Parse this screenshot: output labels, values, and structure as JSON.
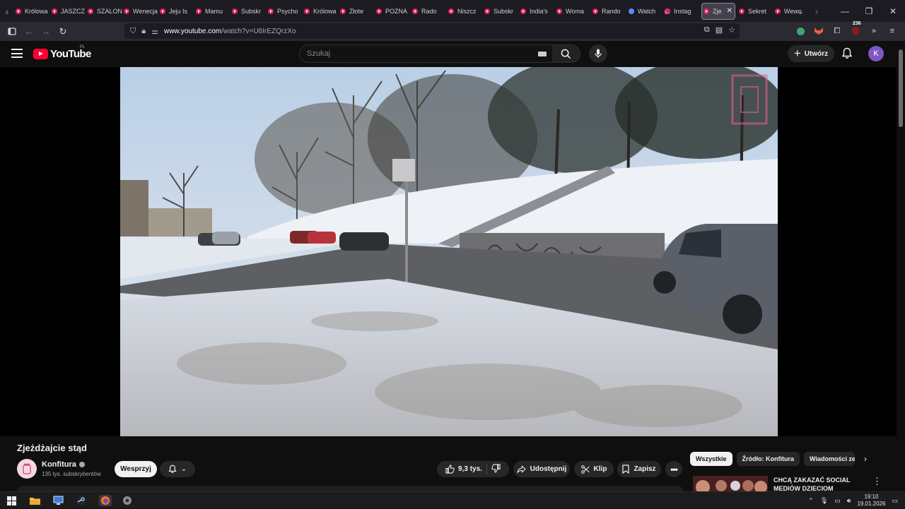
{
  "browser": {
    "tabs": [
      {
        "label": "Królowa",
        "fav": "yt"
      },
      {
        "label": "JASZCZ",
        "fav": "yt"
      },
      {
        "label": "SZALON",
        "fav": "yt"
      },
      {
        "label": "Wenecja",
        "fav": "yt"
      },
      {
        "label": "Jeju Is",
        "fav": "yt"
      },
      {
        "label": "Mamu",
        "fav": "yt"
      },
      {
        "label": "Subskr",
        "fav": "yt"
      },
      {
        "label": "Psycho",
        "fav": "yt"
      },
      {
        "label": "Królowa",
        "fav": "yt"
      },
      {
        "label": "Złote",
        "fav": "yt"
      },
      {
        "label": "POZNA",
        "fav": "yt"
      },
      {
        "label": "Rado",
        "fav": "yt"
      },
      {
        "label": "Niszcz",
        "fav": "yt"
      },
      {
        "label": "Subskr",
        "fav": "yt"
      },
      {
        "label": "India's",
        "fav": "yt"
      },
      {
        "label": "Woma",
        "fav": "yt"
      },
      {
        "label": "Rando",
        "fav": "yt"
      },
      {
        "label": "Watch",
        "fav": "blue"
      },
      {
        "label": "Instag",
        "fav": "insta"
      },
      {
        "label": "Zje",
        "fav": "yt",
        "active": true
      },
      {
        "label": "Sekret",
        "fav": "yt"
      },
      {
        "label": "Wewn",
        "fav": "yt"
      }
    ],
    "url_host": "www.youtube.com",
    "url_rest": "/watch?v=U6IrEZQrzXo",
    "extension_badge": "236"
  },
  "youtube": {
    "logo_text": "YouTube",
    "country_code": "PL",
    "search_placeholder": "Szukaj",
    "create_label": "Utwórz",
    "avatar_letter": "K"
  },
  "video": {
    "title": "Zjeżdżajcie stąd",
    "channel": "Konfitura",
    "subscribers": "135 tys. subskrybentów",
    "support_label": "Wesprzyj",
    "likes": "9,3 tys.",
    "share_label": "Udostępnij",
    "clip_label": "Klip",
    "save_label": "Zapisz"
  },
  "sidebar": {
    "chips": [
      "Wszystkie",
      "Źródło: Konfitura",
      "Wiadomości ze"
    ],
    "recommendation_title": "CHCĄ ZAKAZAĆ SOCIAL MEDIÓW DZIECIOM"
  },
  "taskbar": {
    "time": "19:10",
    "date": "19.01.2026"
  }
}
